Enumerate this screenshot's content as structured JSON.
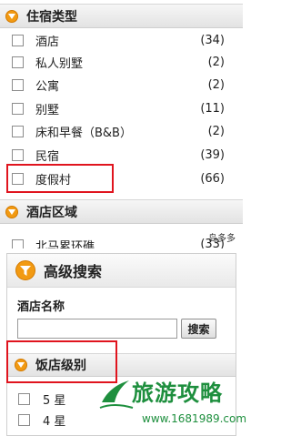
{
  "accommodation": {
    "title": "住宿类型",
    "items": [
      {
        "label": "酒店",
        "count": "(34)"
      },
      {
        "label": "私人别墅",
        "count": "(2)"
      },
      {
        "label": "公寓",
        "count": "(2)"
      },
      {
        "label": "别墅",
        "count": "(11)"
      },
      {
        "label": "床和早餐（B&B）",
        "count": "(2)"
      },
      {
        "label": "民宿",
        "count": "(39)"
      },
      {
        "label": "度假村",
        "count": "(66)"
      }
    ]
  },
  "hotel_area": {
    "title": "酒店区域",
    "items": [
      {
        "label": "北马累环礁",
        "count": "(33)"
      }
    ]
  },
  "advanced_search": {
    "title": "高级搜索",
    "hotel_name_label": "酒店名称",
    "hotel_name_value": "",
    "search_button": "搜索",
    "star_title": "饭店级别",
    "star_items": [
      {
        "label": "5 星"
      },
      {
        "label": "4 星"
      }
    ]
  },
  "watermarks": {
    "site_small": "岛多多",
    "brand": "旅游攻略",
    "url": "www.1681989.com"
  },
  "colors": {
    "accent": "#f29a12",
    "highlight": "#e0141e",
    "watermark": "#1e8f3e"
  }
}
